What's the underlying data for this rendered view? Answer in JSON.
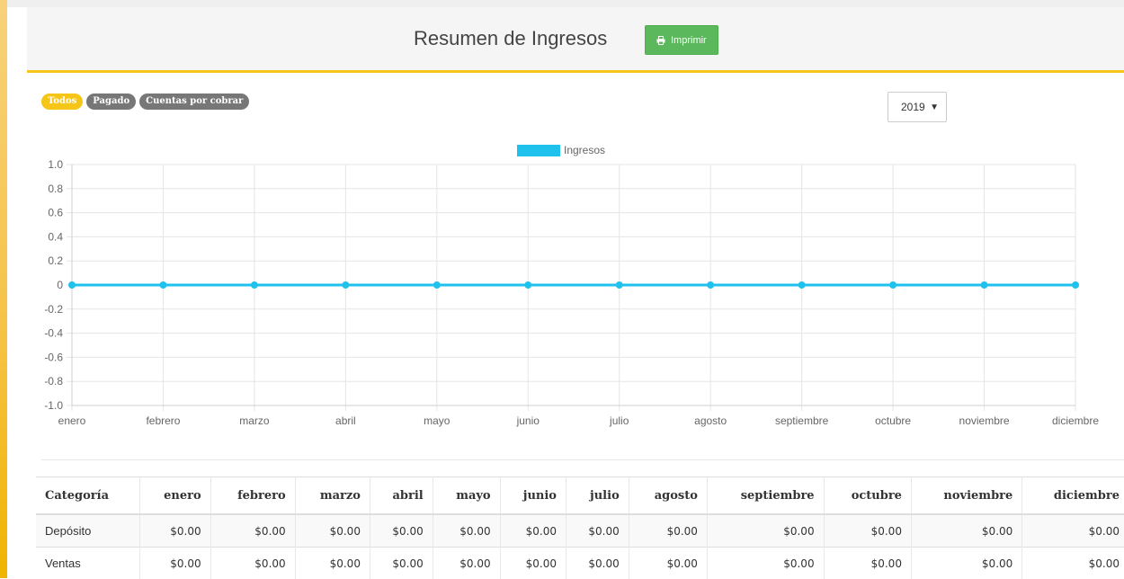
{
  "header": {
    "title": "Resumen de Ingresos",
    "print_label": "Imprimir"
  },
  "filters": [
    "Todos",
    "Pagado",
    "Cuentas por cobrar"
  ],
  "filter_active": "Todos",
  "year_select": {
    "value": "2019"
  },
  "colors": {
    "accent": "#f5c518",
    "print_button": "#5cb85c",
    "series": "#1fc2ec",
    "pill_inactive": "#777777"
  },
  "chart_data": {
    "type": "line",
    "categories": [
      "enero",
      "febrero",
      "marzo",
      "abril",
      "mayo",
      "junio",
      "julio",
      "agosto",
      "septiembre",
      "octubre",
      "noviembre",
      "diciembre"
    ],
    "series": [
      {
        "name": "Ingresos",
        "values": [
          0,
          0,
          0,
          0,
          0,
          0,
          0,
          0,
          0,
          0,
          0,
          0
        ]
      }
    ],
    "yticks": [
      "1.0",
      "0.8",
      "0.6",
      "0.4",
      "0.2",
      "0",
      "-0.2",
      "-0.4",
      "-0.6",
      "-0.8",
      "-1.0"
    ],
    "ylim": [
      -1.0,
      1.0
    ],
    "legend": "top-center",
    "grid": true
  },
  "table": {
    "headers": [
      "Categoría",
      "enero",
      "febrero",
      "marzo",
      "abril",
      "mayo",
      "junio",
      "julio",
      "agosto",
      "septiembre",
      "octubre",
      "noviembre",
      "diciembre"
    ],
    "rows": [
      [
        "Depósito",
        "$0.00",
        "$0.00",
        "$0.00",
        "$0.00",
        "$0.00",
        "$0.00",
        "$0.00",
        "$0.00",
        "$0.00",
        "$0.00",
        "$0.00",
        "$0.00"
      ],
      [
        "Ventas",
        "$0.00",
        "$0.00",
        "$0.00",
        "$0.00",
        "$0.00",
        "$0.00",
        "$0.00",
        "$0.00",
        "$0.00",
        "$0.00",
        "$0.00",
        "$0.00"
      ]
    ]
  }
}
